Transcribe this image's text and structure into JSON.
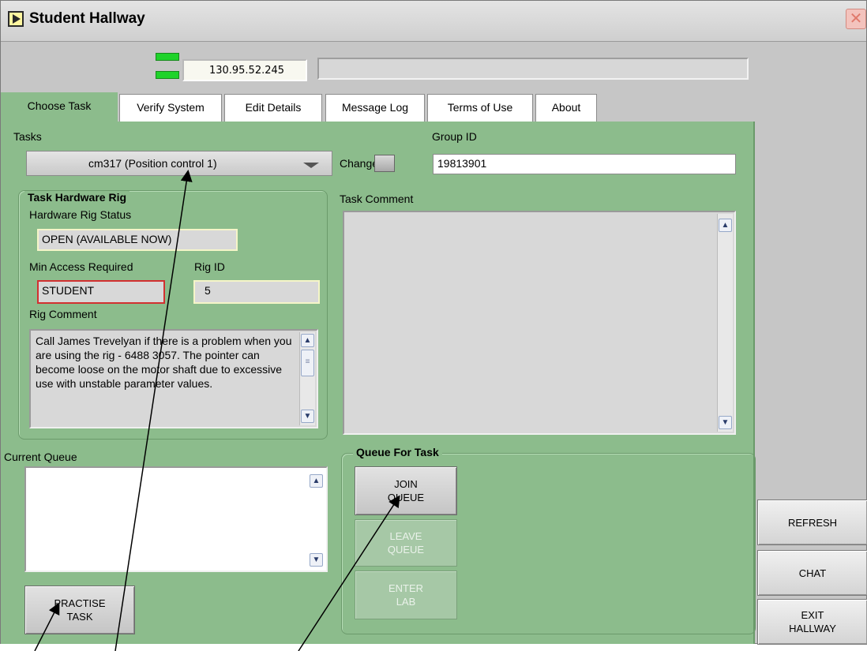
{
  "window": {
    "title": "Student Hallway",
    "close_symbol": "✕"
  },
  "status": {
    "ip_address": "130.95.52.245",
    "message": ""
  },
  "tabs": [
    {
      "label": "Choose Task",
      "active": true
    },
    {
      "label": "Verify System",
      "active": false
    },
    {
      "label": "Edit Details",
      "active": false
    },
    {
      "label": "Message Log",
      "active": false
    },
    {
      "label": "Terms of Use",
      "active": false
    },
    {
      "label": "About",
      "active": false
    }
  ],
  "choose_task": {
    "tasks_label": "Tasks",
    "selected_task": "cm317 (Position control 1)",
    "group_id_label": "Group ID",
    "change_label": "Change",
    "group_id_value": "19813901",
    "task_comment_label": "Task Comment",
    "task_comment": "",
    "hardware": {
      "title": "Task Hardware Rig",
      "status_label": "Hardware Rig Status",
      "status_value": "OPEN (AVAILABLE NOW)",
      "min_access_label": "Min Access Required",
      "min_access_value": "STUDENT",
      "rig_id_label": "Rig ID",
      "rig_id_value": "5",
      "rig_comment_label": "Rig Comment",
      "rig_comment": "Call James Trevelyan if there is a problem when you are using the rig - 6488 3057.  The pointer can become loose on the motor shaft due to excessive use with unstable parameter values."
    },
    "current_queue_label": "Current Queue",
    "queue_box": {
      "title": "Queue For Task",
      "join_line1": "JOIN",
      "join_line2": "QUEUE",
      "leave_line1": "LEAVE",
      "leave_line2": "QUEUE",
      "enter_line1": "ENTER",
      "enter_line2": "LAB"
    },
    "practise_line1": "PRACTISE",
    "practise_line2": "TASK"
  },
  "side_buttons": {
    "refresh": "REFRESH",
    "chat": "CHAT",
    "exit_line1": "EXIT",
    "exit_line2": "HALLWAY"
  },
  "colors": {
    "panel": "#8cbc8c",
    "led": "#1fd32a",
    "min_access_border": "#d23030"
  }
}
